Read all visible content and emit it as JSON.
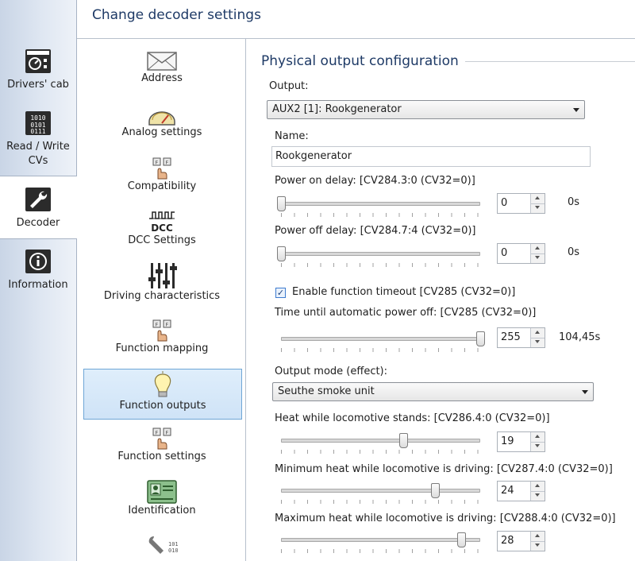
{
  "header": {
    "title": "Change decoder settings"
  },
  "rail": {
    "items": [
      {
        "label": "Drivers' cab",
        "icon": "drivers-cab-icon"
      },
      {
        "label": "Read / Write CVs",
        "icon": "read-write-cvs-icon"
      },
      {
        "label": "Decoder",
        "icon": "wrench-icon",
        "selected": true
      },
      {
        "label": "Information",
        "icon": "info-icon"
      }
    ]
  },
  "categories": [
    {
      "label": "Address",
      "icon": "envelope-icon"
    },
    {
      "label": "Analog settings",
      "icon": "gauge-icon"
    },
    {
      "label": "Compatibility",
      "icon": "function-keys-icon"
    },
    {
      "label": "DCC Settings",
      "icon": "dcc-icon",
      "icon_text": "DCC"
    },
    {
      "label": "Driving characteristics",
      "icon": "sliders-icon"
    },
    {
      "label": "Function mapping",
      "icon": "function-keys-icon"
    },
    {
      "label": "Function outputs",
      "icon": "lightbulb-icon",
      "selected": true
    },
    {
      "label": "Function settings",
      "icon": "function-keys-icon"
    },
    {
      "label": "Identification",
      "icon": "id-card-icon"
    },
    {
      "label": "",
      "icon": "wrench-binary-icon"
    }
  ],
  "section": {
    "title": "Physical output configuration",
    "output_label": "Output:",
    "output_value": "AUX2 [1]: Rookgenerator",
    "name_label": "Name:",
    "name_value": "Rookgenerator",
    "power_on": {
      "label": "Power on delay: [CV284.3:0 (CV32=0)]",
      "value": "0",
      "unit": "0s",
      "fraction": 0.0
    },
    "power_off": {
      "label": "Power off delay: [CV284.7:4 (CV32=0)]",
      "value": "0",
      "unit": "0s",
      "fraction": 0.0
    },
    "timeout_checkbox": {
      "label": "Enable function timeout [CV285 (CV32=0)]",
      "checked": true
    },
    "auto_off": {
      "label": "Time until automatic power off: [CV285 (CV32=0)]",
      "value": "255",
      "unit": "104,45s",
      "fraction": 1.0
    },
    "mode_label": "Output mode (effect):",
    "mode_value": "Seuthe smoke unit",
    "heat_stand": {
      "label": "Heat while locomotive stands: [CV286.4:0 (CV32=0)]",
      "value": "19",
      "fraction": 0.613
    },
    "heat_min": {
      "label": "Minimum heat while locomotive is driving: [CV287.4:0 (CV32=0)]",
      "value": "24",
      "fraction": 0.774
    },
    "heat_max": {
      "label": "Maximum heat while locomotive is driving: [CV288.4:0 (CV32=0)]",
      "value": "28",
      "fraction": 0.903
    }
  }
}
